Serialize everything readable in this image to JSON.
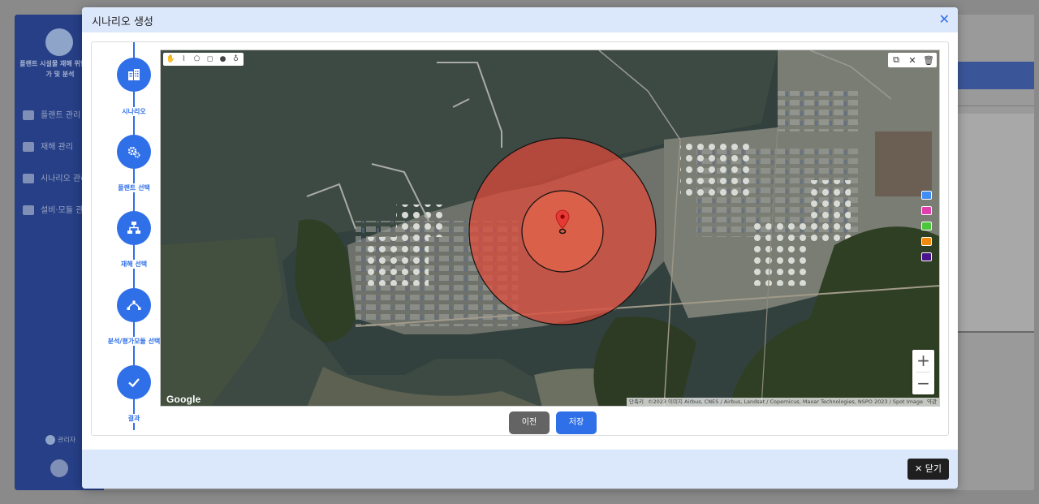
{
  "background": {
    "sidebar_title": "플랜트 시설물 재해 위험도 평가 및 분석",
    "menu": [
      "플랜트 관리",
      "재해 관리",
      "시나리오 관리",
      "설비·모듈 관리"
    ],
    "user": "관리자"
  },
  "modal": {
    "title": "시나리오 생성",
    "close_label": "닫기",
    "prev_label": "이전",
    "save_label": "저장"
  },
  "steps": [
    {
      "label": "시나리오",
      "icon": "building-icon"
    },
    {
      "label": "플랜트 선택",
      "icon": "gears-icon"
    },
    {
      "label": "재해 선택",
      "icon": "hierarchy-icon"
    },
    {
      "label": "분석/평가모듈 선택",
      "icon": "bezier-icon"
    },
    {
      "label": "결과",
      "icon": "check-icon"
    }
  ],
  "map": {
    "logo": "Google",
    "attribution": [
      "단축키",
      "©2023 이미지 Airbus, CNES / Airbus, Landsat / Copernicus, Maxar Technologies, NSPO 2023 / Spot Image",
      "약관"
    ],
    "palette": [
      "#3f8ef5",
      "#e23fae",
      "#4cc63a",
      "#f2880c",
      "#4a148c"
    ],
    "zoom_in": "+",
    "zoom_out": "−"
  }
}
